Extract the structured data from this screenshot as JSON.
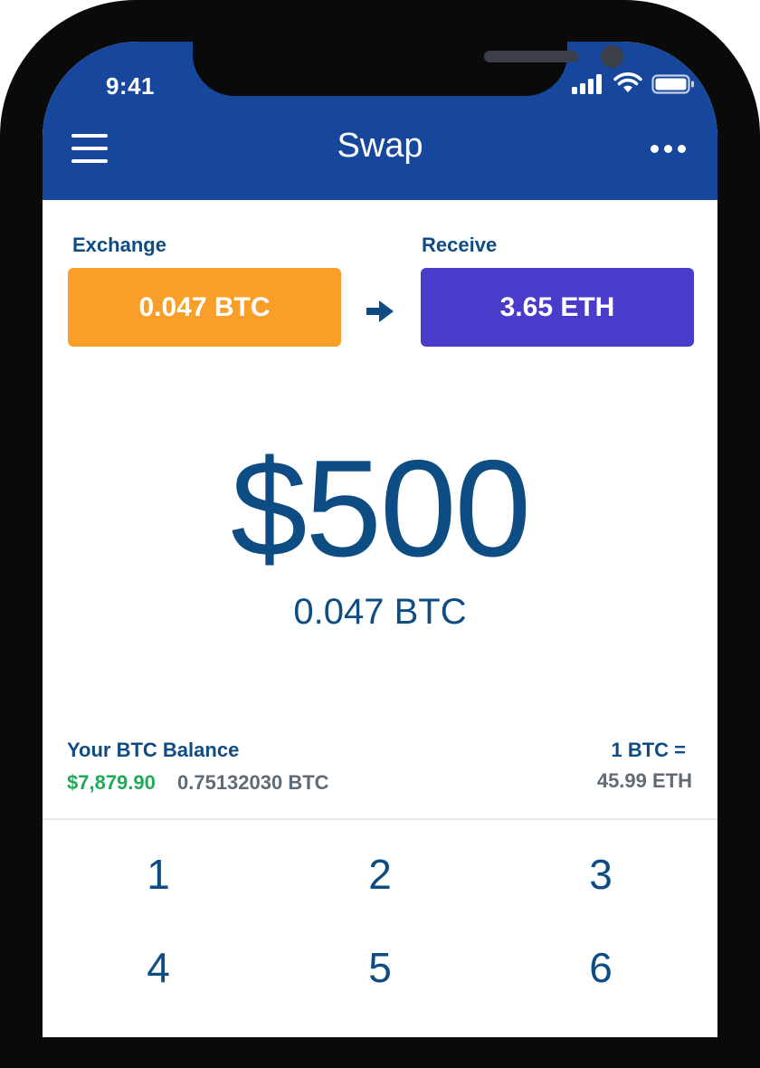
{
  "status_bar": {
    "time": "9:41",
    "icons": [
      "cellular-signal-icon",
      "wifi-icon",
      "battery-icon"
    ]
  },
  "header": {
    "title": "Swap",
    "left_icon": "hamburger-menu-icon",
    "right_icon": "more-options-icon"
  },
  "swap": {
    "exchange_label": "Exchange",
    "exchange_value": "0.047 BTC",
    "receive_label": "Receive",
    "receive_value": "3.65 ETH",
    "arrow_icon": "arrow-right-icon"
  },
  "amount": {
    "fiat": "$500",
    "crypto": "0.047 BTC"
  },
  "balance": {
    "title": "Your BTC Balance",
    "usd": "$7,879.90",
    "btc": "0.75132030 BTC"
  },
  "rate": {
    "line1": "1 BTC =",
    "line2": "45.99 ETH"
  },
  "keypad": {
    "keys": [
      "1",
      "2",
      "3",
      "4",
      "5",
      "6"
    ]
  },
  "colors": {
    "header_bg": "#17479c",
    "exchange_bg": "#f99e28",
    "receive_bg": "#4a3ccb",
    "primary_text": "#0d4d83",
    "positive": "#1fab57",
    "muted": "#5f6b75"
  }
}
